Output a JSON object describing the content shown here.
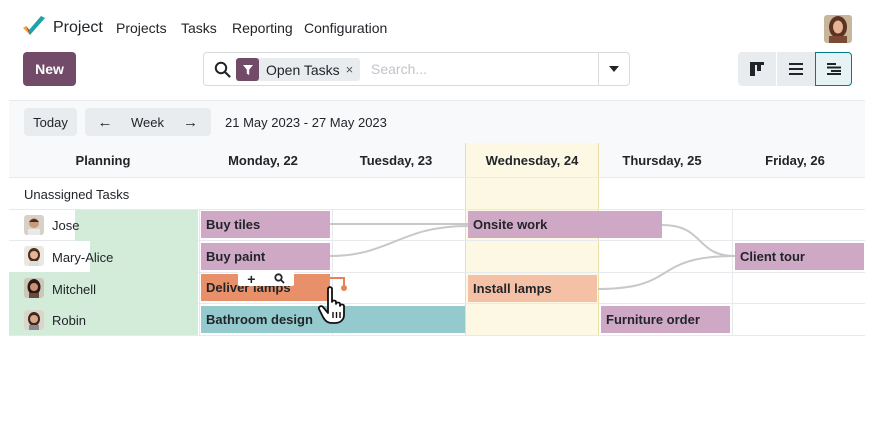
{
  "nav": {
    "app_name": "Project",
    "items": [
      "Projects",
      "Tasks",
      "Reporting",
      "Configuration"
    ]
  },
  "control": {
    "new_label": "New",
    "facet_label": "Open Tasks",
    "facet_remove": "×",
    "search_placeholder": "Search...",
    "views": [
      "kanban-icon",
      "list-icon",
      "gantt-icon"
    ],
    "active_view": "gantt"
  },
  "gantt": {
    "today_label": "Today",
    "prev_label": "←",
    "scale_label": "Week",
    "next_label": "→",
    "date_range": "21 May 2023 - 27 May 2023",
    "columns": [
      "Planning",
      "Monday, 22",
      "Tuesday, 23",
      "Wednesday, 24",
      "Thursday, 25",
      "Friday, 26"
    ],
    "today_column": "Wednesday, 24",
    "unassigned_label": "Unassigned Tasks",
    "rows": [
      {
        "name": "Jose"
      },
      {
        "name": "Mary-Alice"
      },
      {
        "name": "Mitchell"
      },
      {
        "name": "Robin"
      }
    ],
    "tasks": [
      {
        "label": "Buy tiles",
        "assignee": "Jose",
        "color": "#cfa8c6"
      },
      {
        "label": "Onsite work",
        "assignee": "Jose",
        "color": "#cfa8c6"
      },
      {
        "label": "Buy paint",
        "assignee": "Mary-Alice",
        "color": "#cfa8c6"
      },
      {
        "label": "Client tour",
        "assignee": "Mary-Alice",
        "color": "#cfa8c6"
      },
      {
        "label": "Deliver lamps",
        "assignee": "Mitchell",
        "color": "#e8906a"
      },
      {
        "label": "Install lamps",
        "assignee": "Mitchell",
        "color": "#f4c1a6"
      },
      {
        "label": "Bathroom design",
        "assignee": "Robin",
        "color": "#94cacd"
      },
      {
        "label": "Furniture order",
        "assignee": "Robin",
        "color": "#cfa8c6"
      }
    ],
    "pill_tools": {
      "plus": "+",
      "zoom": "🔍"
    }
  },
  "colors": {
    "brand": "#714b67",
    "accent": "#017e84",
    "today_highlight": "#fcf8e3",
    "row_planning": "#d3ecd9"
  }
}
